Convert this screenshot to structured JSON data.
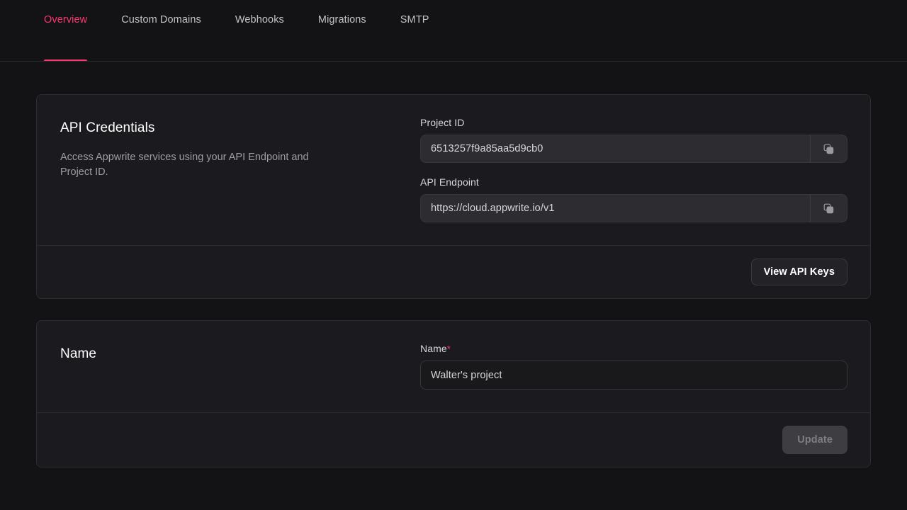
{
  "theme": {
    "accent": "#fd366e",
    "page_bg": "#131316",
    "card_bg": "#1b1b1f",
    "card_border": "#2c2c30",
    "readonly_input_bg": "#2d2d31",
    "input_bg": "#19191c",
    "text_primary": "#ffffff",
    "text_muted": "#9c9ca3",
    "disabled_btn_bg": "#3d3d42",
    "disabled_btn_text": "#7d7d84"
  },
  "tabs": [
    {
      "label": "Overview",
      "active": true
    },
    {
      "label": "Custom Domains",
      "active": false
    },
    {
      "label": "Webhooks",
      "active": false
    },
    {
      "label": "Migrations",
      "active": false
    },
    {
      "label": "SMTP",
      "active": false
    }
  ],
  "api_credentials": {
    "title": "API Credentials",
    "description": "Access Appwrite services using your API Endpoint and Project ID.",
    "project_id": {
      "label": "Project ID",
      "value": "6513257f9a85aa5d9cb0",
      "copy_icon": "copy-icon"
    },
    "api_endpoint": {
      "label": "API Endpoint",
      "value": "https://cloud.appwrite.io/v1",
      "copy_icon": "copy-icon"
    },
    "footer": {
      "view_api_keys_label": "View API Keys"
    }
  },
  "name_section": {
    "title": "Name",
    "field": {
      "label": "Name",
      "required_marker": "*",
      "value": "Walter's project",
      "placeholder": "Walter's project"
    },
    "footer": {
      "update_label": "Update",
      "update_disabled": true
    }
  }
}
